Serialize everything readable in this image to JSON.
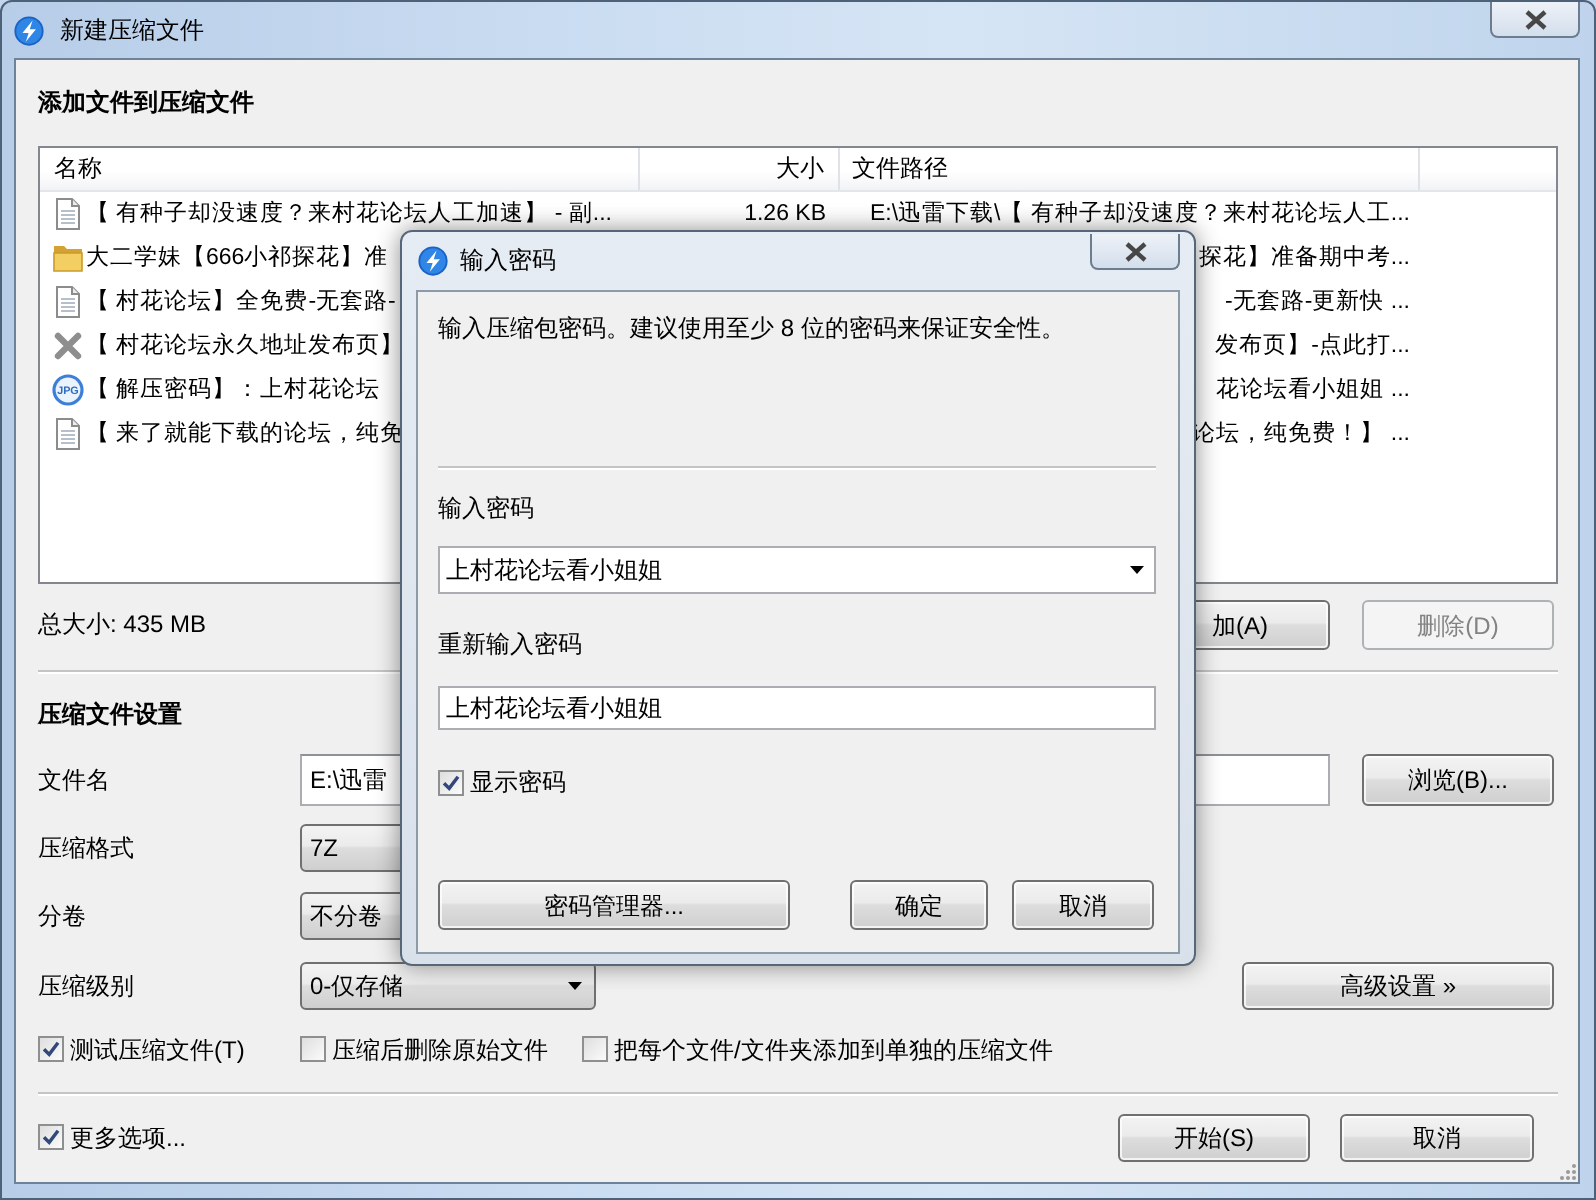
{
  "window": {
    "title": "新建压缩文件"
  },
  "add_section": {
    "title": "添加文件到压缩文件"
  },
  "file_list": {
    "columns": [
      "名称",
      "大小",
      "文件路径"
    ],
    "rows": [
      {
        "kind": "document",
        "name": "【 有种子却没速度？来村花论坛人工加速】 - 副...",
        "size": "1.26 KB",
        "path": "E:\\迅雷下载\\【 有种子却没速度？来村花论坛人工..."
      },
      {
        "kind": "folder",
        "name": "大二学妹【666小祁探花】准",
        "path": "探花】准备期中考..."
      },
      {
        "kind": "document",
        "name": "【 村花论坛】全免费-无套路-",
        "path": "-无套路-更新快 ..."
      },
      {
        "kind": "unknown",
        "name": "【 村花论坛永久地址发布页】",
        "path": "发布页】-点此打..."
      },
      {
        "kind": "image",
        "icon_label": "JPG",
        "name": "【 解压密码】：上村花论坛",
        "path": "花论坛看小姐姐 ..."
      },
      {
        "kind": "document",
        "name": "【 来了就能下载的论坛，纯免",
        "path": "论坛，纯免费！】 ..."
      }
    ]
  },
  "total_size": "总大小: 435 MB",
  "list_buttons": [
    {
      "label": "加(A)",
      "disabled": false
    },
    {
      "label": "删除(D)",
      "disabled": true
    }
  ],
  "settings": {
    "title": "压缩文件设置",
    "fields": [
      {
        "label": "文件名",
        "kind": "text",
        "value": "E:\\迅雷",
        "button": "浏览(B)..."
      },
      {
        "label": "压缩格式",
        "kind": "select",
        "value": "7Z"
      },
      {
        "label": "分卷",
        "kind": "select",
        "value": "不分卷"
      },
      {
        "label": "压缩级别",
        "kind": "select",
        "value": "0-仅存储",
        "arrow": true,
        "button": "高级设置 »"
      }
    ]
  },
  "options": [
    {
      "label": "测试压缩文件(T)",
      "checked": true
    },
    {
      "label": "压缩后删除原始文件",
      "checked": false
    },
    {
      "label": "把每个文件/文件夹添加到单独的压缩文件",
      "checked": false
    }
  ],
  "more_options": {
    "label": "更多选项...",
    "checked": true
  },
  "footer_buttons": [
    "开始(S)",
    "取消"
  ],
  "password_dialog": {
    "title": "输入密码",
    "message": "输入压缩包密码。建议使用至少 8 位的密码来保证安全性。",
    "fields": [
      {
        "label": "输入密码",
        "kind": "combo",
        "value": "上村花论坛看小姐姐"
      },
      {
        "label": "重新输入密码",
        "kind": "text",
        "value": "上村花论坛看小姐姐"
      }
    ],
    "show_password": {
      "label": "显示密码",
      "checked": true
    },
    "manager_button": "密码管理器...",
    "buttons": [
      "确定",
      "取消"
    ]
  }
}
